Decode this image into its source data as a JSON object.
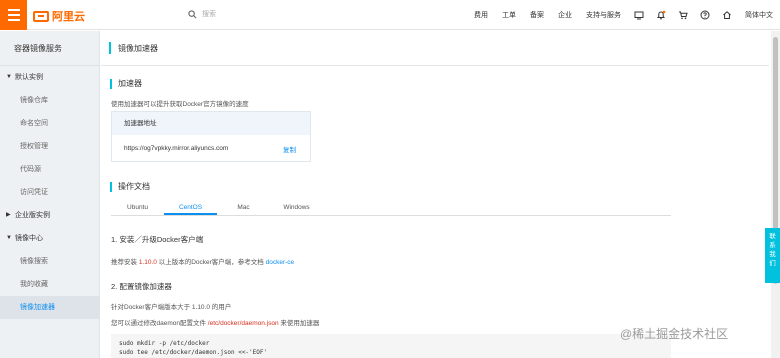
{
  "header": {
    "brand": "阿里云",
    "search_placeholder": "搜索",
    "nav": [
      "费用",
      "工单",
      "备案",
      "企业",
      "支持与服务"
    ],
    "language": "简体中文",
    "icons": [
      "monitor-icon",
      "bell-icon",
      "cart-icon",
      "help-icon",
      "home-icon"
    ]
  },
  "sidebar": {
    "title": "容器镜像服务",
    "group_default": "默认实例",
    "items": [
      "镜像仓库",
      "命名空间",
      "授权管理",
      "代码源",
      "访问凭证"
    ],
    "group_enterprise": "企业版实例",
    "group_mirror": "镜像中心",
    "mirror_items": [
      "镜像搜索",
      "我的收藏",
      "镜像加速器"
    ]
  },
  "main": {
    "page_title": "镜像加速器",
    "accelerator": {
      "heading": "加速器",
      "description": "使用加速器可以提升获取Docker官方镜像的速度",
      "box_header": "加速器地址",
      "url": "https://og7vpkky.mirror.aliyuncs.com",
      "copy_label": "复制"
    },
    "docs": {
      "heading": "操作文档",
      "tabs": [
        "Ubuntu",
        "CentOS",
        "Mac",
        "Windows"
      ],
      "active_tab": "CentOS",
      "step1_title": "1. 安装／升级Docker客户端",
      "step1_prefix": "推荐安装 ",
      "step1_version": "1.10.0",
      "step1_middle": " 以上版本的Docker客户端，参考文档 ",
      "step1_link": "docker-ce",
      "step2_title": "2. 配置镜像加速器",
      "step2_line1": "针对Docker客户端版本大于 1.10.0 的用户",
      "step2_prefix": "您可以通过修改daemon配置文件 ",
      "step2_path": "/etc/docker/daemon.json",
      "step2_suffix": " 来使用加速器",
      "code_lines": [
        "sudo mkdir -p /etc/docker",
        "sudo tee /etc/docker/daemon.json <<-'EOF'"
      ]
    }
  },
  "contact_label": "联系我们",
  "watermark": "@稀土掘金技术社区"
}
